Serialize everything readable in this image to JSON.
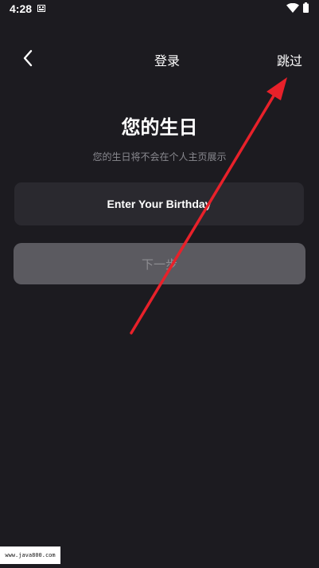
{
  "status_bar": {
    "time": "4:28",
    "icons": [
      "notification-icon",
      "wifi-icon",
      "battery-icon"
    ]
  },
  "nav": {
    "back_icon": "chevron-left-icon",
    "title": "登录",
    "skip_label": "跳过"
  },
  "main": {
    "title": "您的生日",
    "subtitle": "您的生日将不会在个人主页展示",
    "birthday_field_label": "Enter Your Birthday",
    "next_label": "下一步"
  },
  "annotation": {
    "arrow_icon": "red-arrow-icon",
    "color": "#e8212a"
  },
  "watermark": {
    "text": "www.java800.com"
  },
  "colors": {
    "background": "#1c1b20",
    "field_background": "#2a292f",
    "button_disabled": "#5b5a60",
    "subtitle_text": "#8a8a90"
  }
}
